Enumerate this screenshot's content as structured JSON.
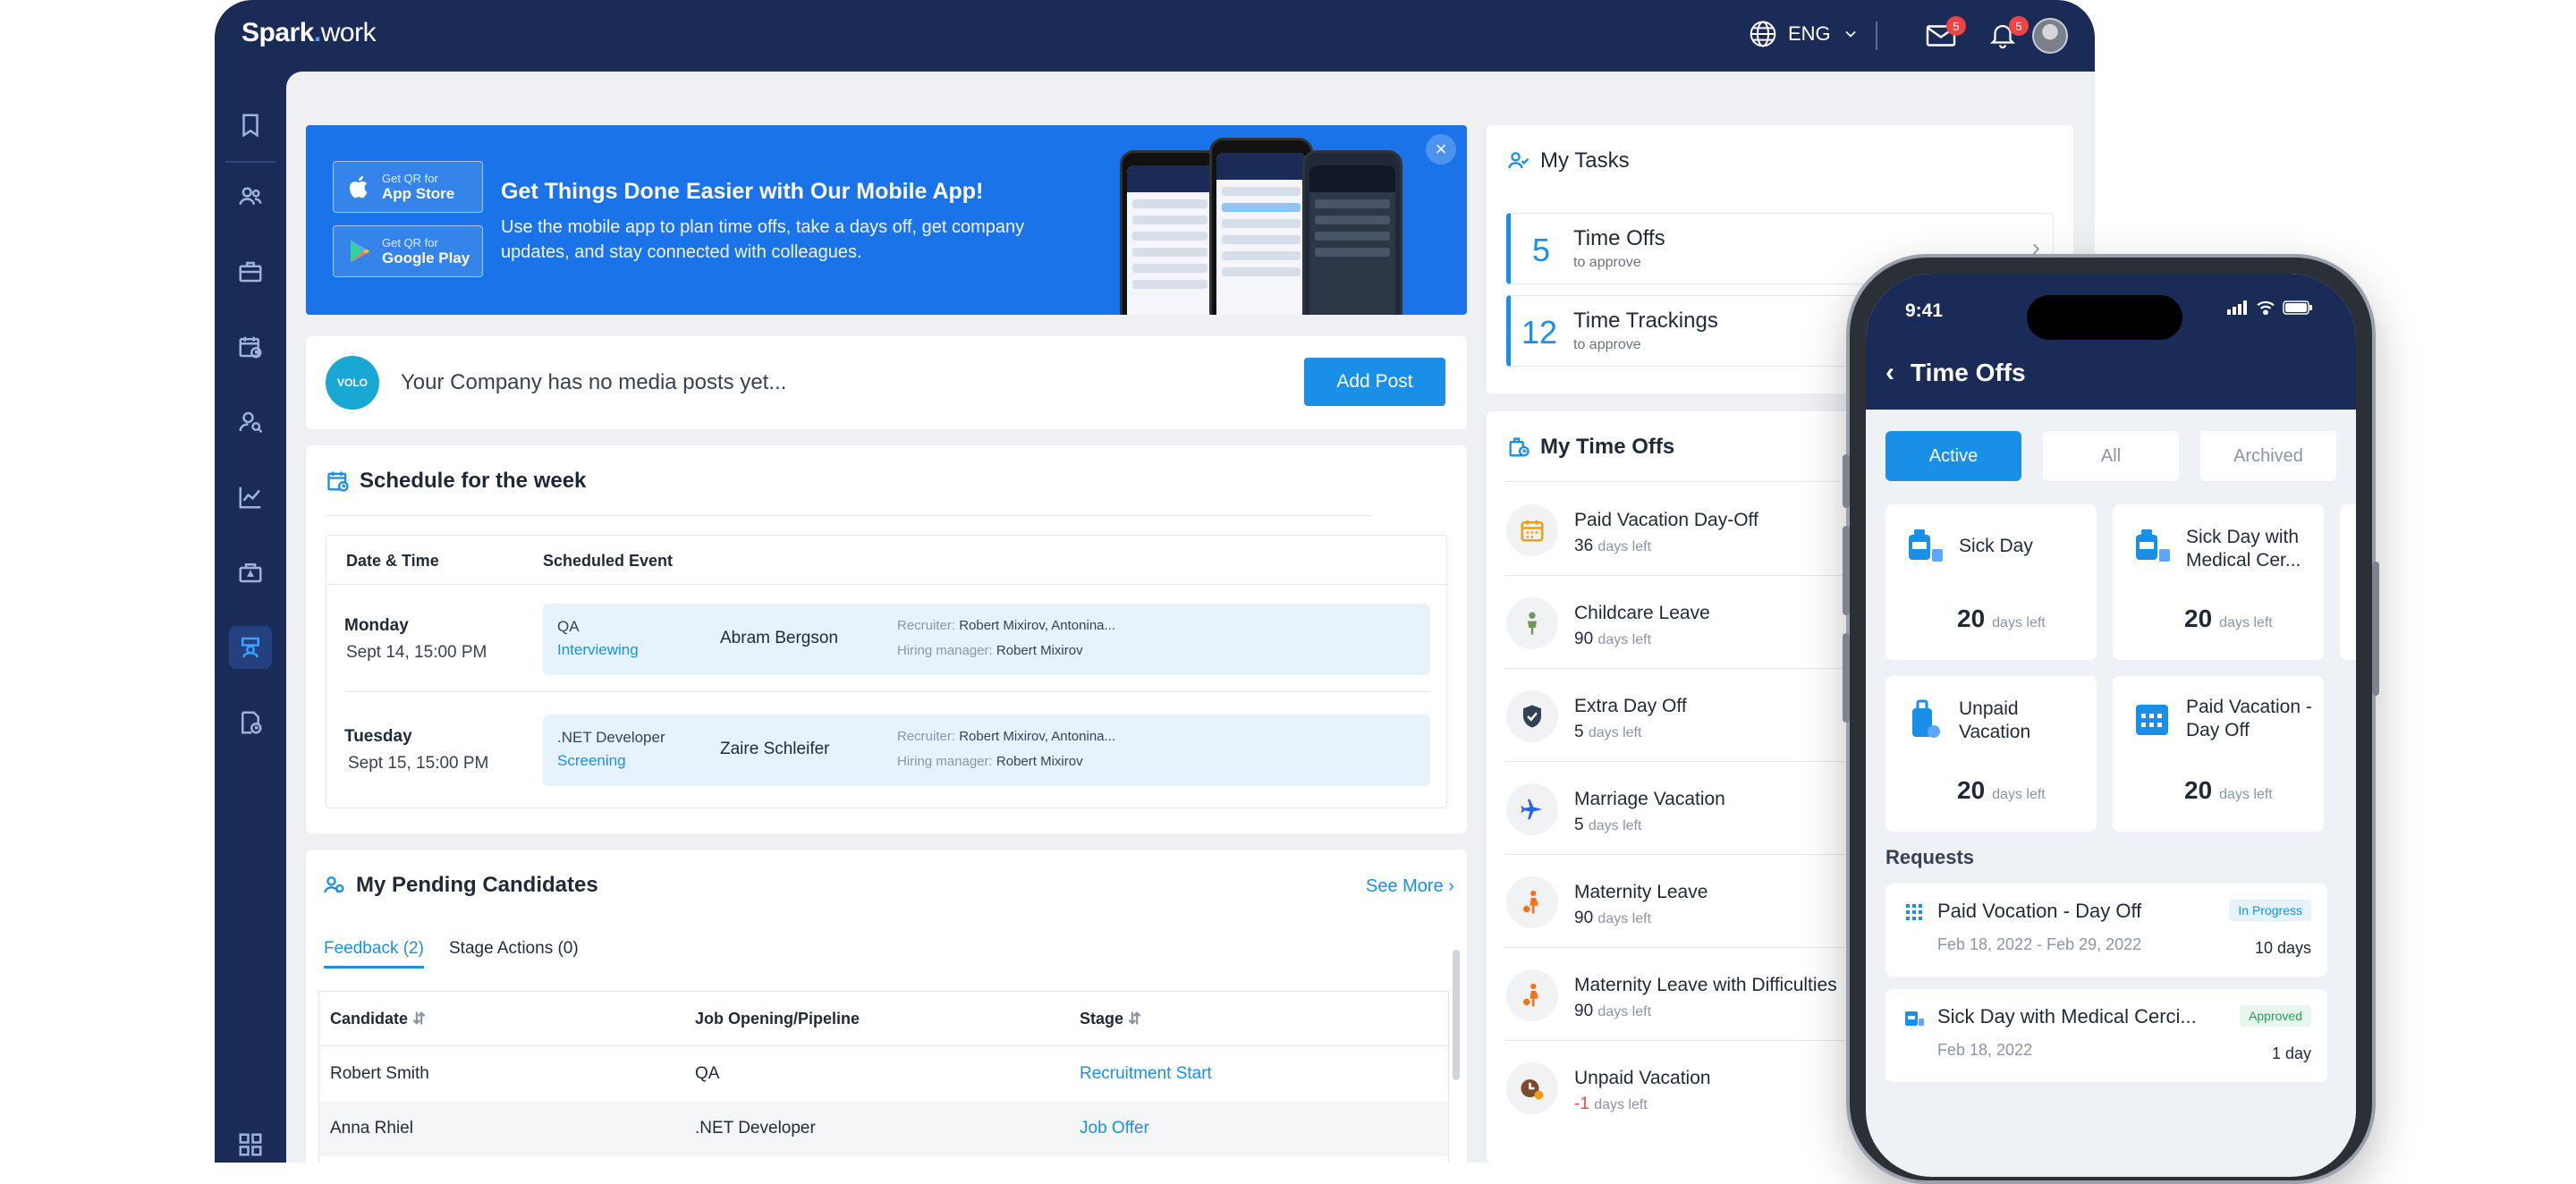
{
  "topbar": {
    "logo_main": "Spark",
    "logo_dot": ".",
    "logo_rest": "work",
    "language": "ENG",
    "mail_count": "5",
    "notif_count": "5"
  },
  "sidebar": {
    "icons": [
      "bookmark-icon",
      "people-icon",
      "briefcase-icon",
      "calendar-clock-icon",
      "user-search-icon",
      "chart-icon",
      "toolbox-icon",
      "interview-icon",
      "document-clock-icon",
      "grid-icon"
    ],
    "active_index": 7
  },
  "promo": {
    "app_store_small": "Get QR for",
    "app_store_label": "App Store",
    "google_play_small": "Get QR for",
    "google_play_label": "Google Play",
    "title": "Get Things Done Easier with Our Mobile App!",
    "subtitle": "Use the mobile app to plan time offs, take a days off, get company updates, and stay connected with colleagues.",
    "close": "×"
  },
  "posts": {
    "company_badge": "VOLO",
    "empty_text": "Your Company has no media posts yet...",
    "add_post": "Add Post"
  },
  "schedule": {
    "title": "Schedule for the week",
    "col_date": "Date & Time",
    "col_event": "Scheduled Event",
    "rows": [
      {
        "day": "Monday",
        "time": "Sept 14, 15:00 PM",
        "role": "QA",
        "stage": "Interviewing",
        "name": "Abram Bergson",
        "recruiter_label": "Recruiter:",
        "recruiter": "Robert Mixirov, Antonina...",
        "hm_label": "Hiring manager:",
        "hm": "Robert Mixirov"
      },
      {
        "day": "Tuesday",
        "time": "Sept 15, 15:00 PM",
        "role": ".NET Developer",
        "stage": "Screening",
        "name": "Zaire Schleifer",
        "recruiter_label": "Recruiter:",
        "recruiter": "Robert Mixirov, Antonina...",
        "hm_label": "Hiring manager:",
        "hm": "Robert Mixirov"
      }
    ]
  },
  "candidates": {
    "title": "My Pending Candidates",
    "see_more": "See More",
    "tab_feedback": "Feedback (2)",
    "tab_stage": "Stage Actions (0)",
    "col_candidate": "Candidate",
    "col_job": "Job Opening/Pipeline",
    "col_stage": "Stage",
    "rows": [
      {
        "candidate": "Robert Smith",
        "job": "QA",
        "stage": "Recruitment Start"
      },
      {
        "candidate": "Anna Rhiel",
        "job": ".NET Developer",
        "stage": "Job Offer"
      }
    ]
  },
  "tasks": {
    "title": "My Tasks",
    "items": [
      {
        "count": "5",
        "label": "Time Offs",
        "sub": "to approve"
      },
      {
        "count": "12",
        "label": "Time Trackings",
        "sub": "to approve"
      }
    ]
  },
  "time_offs": {
    "title": "My Time Offs",
    "days_left_label": "days left",
    "items": [
      {
        "name": "Paid Vacation Day-Off",
        "days": "36",
        "icon": "calendar-icon",
        "color": "#f59e0b"
      },
      {
        "name": "Childcare Leave",
        "days": "90",
        "icon": "child-icon",
        "color": "#6b9b5a"
      },
      {
        "name": "Extra Day Off",
        "days": "5",
        "icon": "shield-icon",
        "color": "#334155"
      },
      {
        "name": "Marriage Vacation",
        "days": "5",
        "icon": "plane-icon",
        "color": "#2563eb"
      },
      {
        "name": "Maternity Leave",
        "days": "90",
        "icon": "pregnant-icon",
        "color": "#f97316"
      },
      {
        "name": "Maternity Leave with Difficulties",
        "days": "90",
        "icon": "pregnant-icon",
        "color": "#f97316"
      },
      {
        "name": "Unpaid Vacation",
        "days": "-1",
        "icon": "money-clock-icon",
        "color": "#b45309"
      }
    ]
  },
  "phone": {
    "time": "9:41",
    "title": "Time Offs",
    "tabs": [
      "Active",
      "All",
      "Archived"
    ],
    "days_left_label": "days left",
    "cards": [
      {
        "name": "Sick Day",
        "days": "20"
      },
      {
        "name": "Sick Day with Medical Cer...",
        "days": "20"
      },
      {
        "name": "Unpaid Vacation",
        "days": "20"
      },
      {
        "name": "Paid Vacation -Day Off",
        "days": "20"
      }
    ],
    "requests_title": "Requests",
    "requests": [
      {
        "name": "Paid Vocation - Day Off",
        "dates": "Feb 18, 2022 - Feb 29, 2022",
        "status": "In Progress",
        "days": "10 days"
      },
      {
        "name": "Sick Day with Medical Cerci...",
        "dates": "Feb 18, 2022",
        "status": "Approved",
        "days": "1 day"
      }
    ]
  },
  "colors": {
    "navy": "#1b2b57",
    "accent": "#1a8fe8",
    "badge": "#ef4444"
  }
}
